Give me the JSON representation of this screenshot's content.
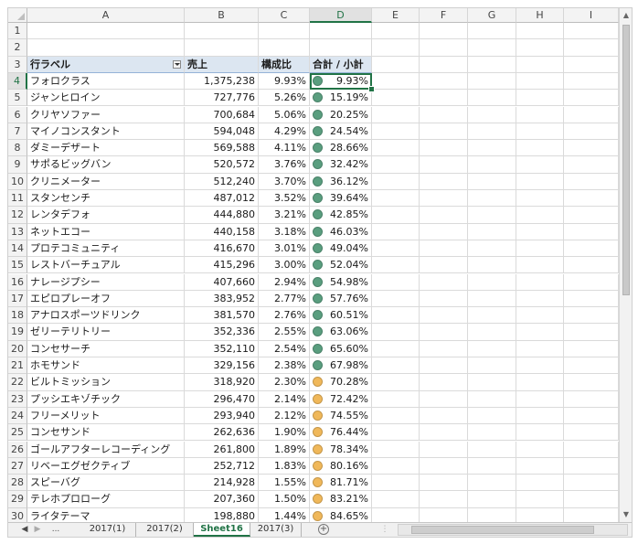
{
  "columns": [
    "A",
    "B",
    "C",
    "D",
    "E",
    "F",
    "G",
    "H",
    "I"
  ],
  "selected_column": "D",
  "selected_row": 4,
  "row_numbers": [
    1,
    2,
    3,
    4,
    5,
    6,
    7,
    8,
    9,
    10,
    11,
    12,
    13,
    14,
    15,
    16,
    17,
    18,
    19,
    20,
    21,
    22,
    23,
    24,
    25,
    26,
    27,
    28,
    29,
    30
  ],
  "pivot_header": {
    "row_label": "行ラベル",
    "sales": "売上",
    "ratio": "構成比",
    "cumulative": "合計 / 小計"
  },
  "rows": [
    {
      "label": "フォロクラス",
      "sales": "1,375,238",
      "ratio": "9.93%",
      "cum": "9.93%",
      "dot": "green"
    },
    {
      "label": "ジャンヒロイン",
      "sales": "727,776",
      "ratio": "5.26%",
      "cum": "15.19%",
      "dot": "green"
    },
    {
      "label": "クリヤソファー",
      "sales": "700,684",
      "ratio": "5.06%",
      "cum": "20.25%",
      "dot": "green"
    },
    {
      "label": "マイノコンスタント",
      "sales": "594,048",
      "ratio": "4.29%",
      "cum": "24.54%",
      "dot": "green"
    },
    {
      "label": "ダミーデザート",
      "sales": "569,588",
      "ratio": "4.11%",
      "cum": "28.66%",
      "dot": "green"
    },
    {
      "label": "サポるビッグバン",
      "sales": "520,572",
      "ratio": "3.76%",
      "cum": "32.42%",
      "dot": "green"
    },
    {
      "label": "クリニメーター",
      "sales": "512,240",
      "ratio": "3.70%",
      "cum": "36.12%",
      "dot": "green"
    },
    {
      "label": "スタンセンチ",
      "sales": "487,012",
      "ratio": "3.52%",
      "cum": "39.64%",
      "dot": "green"
    },
    {
      "label": "レンタデフォ",
      "sales": "444,880",
      "ratio": "3.21%",
      "cum": "42.85%",
      "dot": "green"
    },
    {
      "label": "ネットエコー",
      "sales": "440,158",
      "ratio": "3.18%",
      "cum": "46.03%",
      "dot": "green"
    },
    {
      "label": "プロテコミュニティ",
      "sales": "416,670",
      "ratio": "3.01%",
      "cum": "49.04%",
      "dot": "green"
    },
    {
      "label": "レストバーチュアル",
      "sales": "415,296",
      "ratio": "3.00%",
      "cum": "52.04%",
      "dot": "green"
    },
    {
      "label": "ナレージプシー",
      "sales": "407,660",
      "ratio": "2.94%",
      "cum": "54.98%",
      "dot": "green"
    },
    {
      "label": "エピロプレーオフ",
      "sales": "383,952",
      "ratio": "2.77%",
      "cum": "57.76%",
      "dot": "green"
    },
    {
      "label": "アナロスポーツドリンク",
      "sales": "381,570",
      "ratio": "2.76%",
      "cum": "60.51%",
      "dot": "green"
    },
    {
      "label": "ゼリーテリトリー",
      "sales": "352,336",
      "ratio": "2.55%",
      "cum": "63.06%",
      "dot": "green"
    },
    {
      "label": "コンセサーチ",
      "sales": "352,110",
      "ratio": "2.54%",
      "cum": "65.60%",
      "dot": "green"
    },
    {
      "label": "ホモサンド",
      "sales": "329,156",
      "ratio": "2.38%",
      "cum": "67.98%",
      "dot": "green"
    },
    {
      "label": "ビルトミッション",
      "sales": "318,920",
      "ratio": "2.30%",
      "cum": "70.28%",
      "dot": "orange"
    },
    {
      "label": "プッシエキゾチック",
      "sales": "296,470",
      "ratio": "2.14%",
      "cum": "72.42%",
      "dot": "orange"
    },
    {
      "label": "フリーメリット",
      "sales": "293,940",
      "ratio": "2.12%",
      "cum": "74.55%",
      "dot": "orange"
    },
    {
      "label": "コンセサンド",
      "sales": "262,636",
      "ratio": "1.90%",
      "cum": "76.44%",
      "dot": "orange"
    },
    {
      "label": "ゴールアフターレコーディング",
      "sales": "261,800",
      "ratio": "1.89%",
      "cum": "78.34%",
      "dot": "orange"
    },
    {
      "label": "リベーエグゼクティブ",
      "sales": "252,712",
      "ratio": "1.83%",
      "cum": "80.16%",
      "dot": "orange"
    },
    {
      "label": "スピーバグ",
      "sales": "214,928",
      "ratio": "1.55%",
      "cum": "81.71%",
      "dot": "orange"
    },
    {
      "label": "テレホプロローグ",
      "sales": "207,360",
      "ratio": "1.50%",
      "cum": "83.21%",
      "dot": "orange"
    },
    {
      "label": "ライタテーマ",
      "sales": "198,880",
      "ratio": "1.44%",
      "cum": "84.65%",
      "dot": "orange"
    }
  ],
  "colors": {
    "green_dot": "#5a9e7f",
    "orange_dot": "#f0b85a",
    "accent": "#217346",
    "pivot_header_bg": "#dce6f1"
  },
  "tabs": {
    "ellipsis": "...",
    "items": [
      {
        "label": "2017(1)",
        "active": false
      },
      {
        "label": "2017(2)",
        "active": false
      },
      {
        "label": "Sheet16",
        "active": true
      },
      {
        "label": "2017(3)",
        "active": false
      }
    ],
    "add_label": "+"
  }
}
